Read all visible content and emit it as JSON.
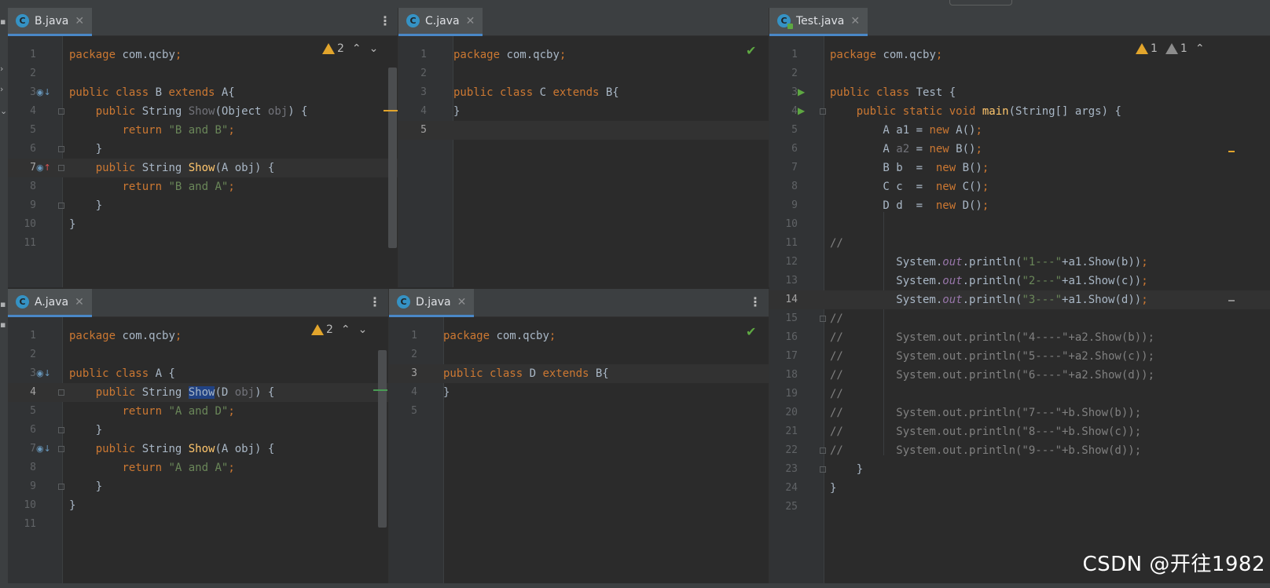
{
  "panes": {
    "b": {
      "tab": "B.java",
      "inspection": "2",
      "lines": [
        [
          "1",
          [
            [
              "k",
              "package "
            ],
            [
              "",
              "com.qcby"
            ],
            [
              "k",
              ";"
            ]
          ]
        ],
        [
          "2",
          []
        ],
        [
          "3",
          [
            [
              "k",
              "public class "
            ],
            [
              "",
              "B "
            ],
            [
              "k",
              "extends "
            ],
            [
              "",
              "A{"
            ]
          ]
        ],
        [
          "4",
          [
            [
              "",
              "    "
            ],
            [
              "k",
              "public "
            ],
            [
              "",
              "String "
            ],
            [
              "dim",
              "Show"
            ],
            [
              "",
              "(Object "
            ],
            [
              "dim",
              "obj"
            ],
            [
              "",
              ") {"
            ]
          ]
        ],
        [
          "5",
          [
            [
              "",
              "        "
            ],
            [
              "k",
              "return "
            ],
            [
              "s",
              "\"B and B\""
            ],
            [
              "k",
              ";"
            ]
          ]
        ],
        [
          "6",
          [
            [
              "",
              "    }"
            ]
          ]
        ],
        [
          "7",
          [
            [
              "",
              "    "
            ],
            [
              "k",
              "public "
            ],
            [
              "",
              "String "
            ],
            [
              "fn",
              "Show"
            ],
            [
              "",
              "(A obj) {"
            ]
          ]
        ],
        [
          "8",
          [
            [
              "",
              "        "
            ],
            [
              "k",
              "return "
            ],
            [
              "s",
              "\"B and A\""
            ],
            [
              "k",
              ";"
            ]
          ]
        ],
        [
          "9",
          [
            [
              "",
              "    }"
            ]
          ]
        ],
        [
          "10",
          [
            [
              "",
              "}"
            ]
          ]
        ],
        [
          "11",
          []
        ]
      ]
    },
    "c": {
      "tab": "C.java",
      "lines": [
        [
          "1",
          [
            [
              "k",
              "package "
            ],
            [
              "",
              "com.qcby"
            ],
            [
              "k",
              ";"
            ]
          ]
        ],
        [
          "2",
          []
        ],
        [
          "3",
          [
            [
              "k",
              "public class "
            ],
            [
              "",
              "C "
            ],
            [
              "k",
              "extends "
            ],
            [
              "",
              "B{"
            ]
          ]
        ],
        [
          "4",
          [
            [
              "",
              "}"
            ]
          ]
        ],
        [
          "5",
          []
        ]
      ]
    },
    "a": {
      "tab": "A.java",
      "inspection": "2",
      "lines": [
        [
          "1",
          [
            [
              "k",
              "package "
            ],
            [
              "",
              "com.qcby"
            ],
            [
              "k",
              ";"
            ]
          ]
        ],
        [
          "2",
          []
        ],
        [
          "3",
          [
            [
              "k",
              "public class "
            ],
            [
              "",
              "A {"
            ]
          ]
        ],
        [
          "4",
          [
            [
              "",
              "    "
            ],
            [
              "k",
              "public "
            ],
            [
              "",
              "String "
            ],
            [
              "hl",
              "Show"
            ],
            [
              "",
              "(D "
            ],
            [
              "dim",
              "obj"
            ],
            [
              "",
              ") {"
            ]
          ]
        ],
        [
          "5",
          [
            [
              "",
              "        "
            ],
            [
              "k",
              "return "
            ],
            [
              "s",
              "\"A and D\""
            ],
            [
              "k",
              ";"
            ]
          ]
        ],
        [
          "6",
          [
            [
              "",
              "    }"
            ]
          ]
        ],
        [
          "7",
          [
            [
              "",
              "    "
            ],
            [
              "k",
              "public "
            ],
            [
              "",
              "String "
            ],
            [
              "fn",
              "Show"
            ],
            [
              "",
              "(A obj) {"
            ]
          ]
        ],
        [
          "8",
          [
            [
              "",
              "        "
            ],
            [
              "k",
              "return "
            ],
            [
              "s",
              "\"A and A\""
            ],
            [
              "k",
              ";"
            ]
          ]
        ],
        [
          "9",
          [
            [
              "",
              "    }"
            ]
          ]
        ],
        [
          "10",
          [
            [
              "",
              "}"
            ]
          ]
        ],
        [
          "11",
          []
        ]
      ]
    },
    "d": {
      "tab": "D.java",
      "lines": [
        [
          "1",
          [
            [
              "k",
              "package "
            ],
            [
              "",
              "com.qcby"
            ],
            [
              "k",
              ";"
            ]
          ]
        ],
        [
          "2",
          []
        ],
        [
          "3",
          [
            [
              "k",
              "public class "
            ],
            [
              "",
              "D "
            ],
            [
              "k",
              "extends "
            ],
            [
              "",
              "B{"
            ]
          ]
        ],
        [
          "4",
          [
            [
              "",
              "}"
            ]
          ]
        ],
        [
          "5",
          []
        ]
      ]
    },
    "test": {
      "tab": "Test.java",
      "warnings": "1",
      "weak_warnings": "1",
      "lines": [
        [
          "1",
          [
            [
              "k",
              "package "
            ],
            [
              "",
              "com.qcby"
            ],
            [
              "k",
              ";"
            ]
          ]
        ],
        [
          "2",
          []
        ],
        [
          "3",
          [
            [
              "k",
              "public class "
            ],
            [
              "",
              "Test {"
            ]
          ]
        ],
        [
          "4",
          [
            [
              "",
              "    "
            ],
            [
              "k",
              "public static void "
            ],
            [
              "fn",
              "main"
            ],
            [
              "",
              "(String[] args) {"
            ]
          ]
        ],
        [
          "5",
          [
            [
              "",
              "        A a1 = "
            ],
            [
              "k",
              "new "
            ],
            [
              "",
              "A()"
            ],
            [
              "k",
              ";"
            ]
          ]
        ],
        [
          "6",
          [
            [
              "",
              "        A "
            ],
            [
              "dim",
              "a2"
            ],
            [
              "",
              " = "
            ],
            [
              "k",
              "new "
            ],
            [
              "",
              "B()"
            ],
            [
              "k",
              ";"
            ]
          ]
        ],
        [
          "7",
          [
            [
              "",
              "        B b  =  "
            ],
            [
              "k",
              "new "
            ],
            [
              "",
              "B()"
            ],
            [
              "k",
              ";"
            ]
          ]
        ],
        [
          "8",
          [
            [
              "",
              "        C c  =  "
            ],
            [
              "k",
              "new "
            ],
            [
              "",
              "C()"
            ],
            [
              "k",
              ";"
            ]
          ]
        ],
        [
          "9",
          [
            [
              "",
              "        D d  =  "
            ],
            [
              "k",
              "new "
            ],
            [
              "",
              "D()"
            ],
            [
              "k",
              ";"
            ]
          ]
        ],
        [
          "10",
          []
        ],
        [
          "11",
          [
            [
              "cm",
              "//"
            ]
          ]
        ],
        [
          "12",
          [
            [
              "",
              "          System."
            ],
            [
              "it",
              "out"
            ],
            [
              "",
              ".println("
            ],
            [
              "s",
              "\"1---\""
            ],
            [
              "",
              "+a1.Show(b))"
            ],
            [
              "k",
              ";"
            ]
          ]
        ],
        [
          "13",
          [
            [
              "",
              "          System."
            ],
            [
              "it",
              "out"
            ],
            [
              "",
              ".println("
            ],
            [
              "s",
              "\"2---\""
            ],
            [
              "",
              "+a1.Show(c))"
            ],
            [
              "k",
              ";"
            ]
          ]
        ],
        [
          "14",
          [
            [
              "",
              "          System."
            ],
            [
              "it",
              "out"
            ],
            [
              "",
              ".println("
            ],
            [
              "s",
              "\"3---\""
            ],
            [
              "",
              "+a1.Show(d))"
            ],
            [
              "k",
              ";"
            ]
          ]
        ],
        [
          "15",
          [
            [
              "cm",
              "//"
            ]
          ]
        ],
        [
          "16",
          [
            [
              "cm",
              "//        System.out.println(\"4----\"+a2.Show(b));"
            ]
          ]
        ],
        [
          "17",
          [
            [
              "cm",
              "//        System.out.println(\"5----\"+a2.Show(c));"
            ]
          ]
        ],
        [
          "18",
          [
            [
              "cm",
              "//        System.out.println(\"6----\"+a2.Show(d));"
            ]
          ]
        ],
        [
          "19",
          [
            [
              "cm",
              "//"
            ]
          ]
        ],
        [
          "20",
          [
            [
              "cm",
              "//        System.out.println(\"7---\"+b.Show(b));"
            ]
          ]
        ],
        [
          "21",
          [
            [
              "cm",
              "//        System.out.println(\"8---\"+b.Show(c));"
            ]
          ]
        ],
        [
          "22",
          [
            [
              "cm",
              "//        System.out.println(\"9---\"+b.Show(d));"
            ]
          ]
        ],
        [
          "23",
          [
            [
              "",
              "    }"
            ]
          ]
        ],
        [
          "24",
          [
            [
              "",
              "}"
            ]
          ]
        ],
        [
          "25",
          []
        ]
      ]
    }
  },
  "watermark": "CSDN @开往1982"
}
